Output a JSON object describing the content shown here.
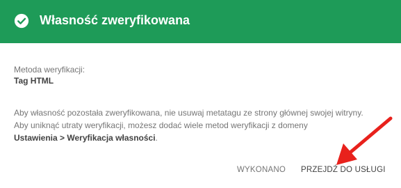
{
  "header": {
    "title": "Własność zweryfikowana",
    "icon": "check-circle-icon",
    "background_color": "#1e9b58"
  },
  "method": {
    "label": "Metoda weryfikacji:",
    "value": "Tag HTML"
  },
  "info": {
    "line1": "Aby własność pozostała zweryfikowana, nie usuwaj metatagu ze strony głównej swojej witryny.",
    "line2": "Aby uniknąć utraty weryfikacji, możesz dodać wiele metod weryfikacji z domeny",
    "line3_bold": "Ustawienia > Weryfikacja własności",
    "line3_tail": "."
  },
  "actions": {
    "done_label": "WYKONANO",
    "go_label": "PRZEJDŹ DO USŁUGI"
  },
  "annotation": {
    "arrow_icon": "red-arrow-icon",
    "color": "#e8211c"
  }
}
